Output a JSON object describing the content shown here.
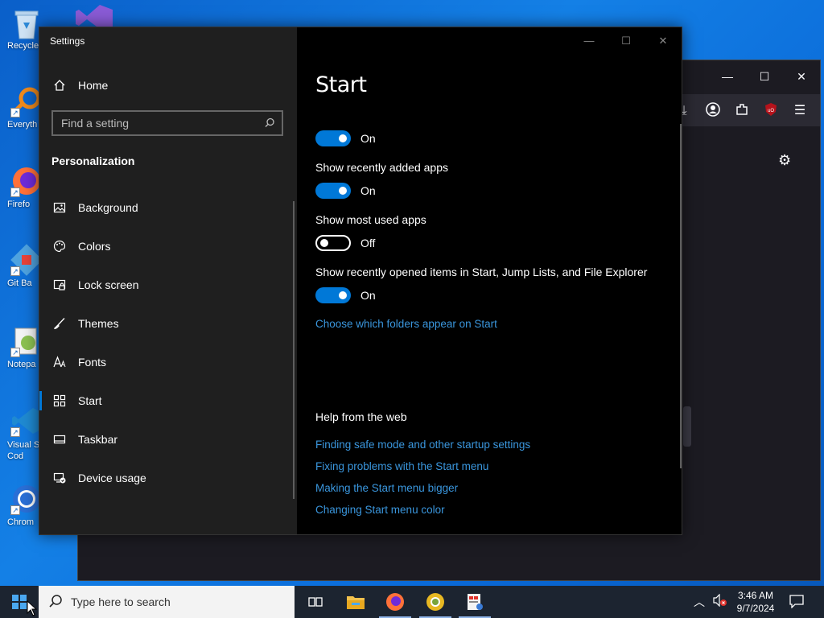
{
  "desktop": {
    "icons": [
      {
        "label": "Recycle",
        "icon": "recycle-bin-icon"
      },
      {
        "label": "Everyth",
        "icon": "everything-search-icon"
      },
      {
        "label": "Firefo",
        "icon": "firefox-icon"
      },
      {
        "label": "Git Ba",
        "icon": "git-bash-icon"
      },
      {
        "label": "Notepa",
        "icon": "notepad-plus-plus-icon"
      },
      {
        "label": "Visual St\nCod",
        "icon": "vscode-icon"
      },
      {
        "label": "Chrom",
        "icon": "chrome-icon"
      }
    ]
  },
  "settings": {
    "app_title": "Settings",
    "home_label": "Home",
    "search_placeholder": "Find a setting",
    "section_title": "Personalization",
    "nav": [
      {
        "label": "Background",
        "icon": "picture-icon"
      },
      {
        "label": "Colors",
        "icon": "palette-icon"
      },
      {
        "label": "Lock screen",
        "icon": "lock-screen-icon"
      },
      {
        "label": "Themes",
        "icon": "brush-icon"
      },
      {
        "label": "Fonts",
        "icon": "fonts-icon"
      },
      {
        "label": "Start",
        "icon": "start-grid-icon",
        "active": true
      },
      {
        "label": "Taskbar",
        "icon": "taskbar-icon"
      },
      {
        "label": "Device usage",
        "icon": "device-usage-icon"
      }
    ],
    "page_heading": "Start",
    "toggles": [
      {
        "label": "",
        "state": "On",
        "on": true
      },
      {
        "label": "Show recently added apps",
        "state": "On",
        "on": true
      },
      {
        "label": "Show most used apps",
        "state": "Off",
        "on": false
      },
      {
        "label": "Show recently opened items in Start, Jump Lists, and File Explorer",
        "state": "On",
        "on": true
      }
    ],
    "folders_link": "Choose which folders appear on Start",
    "help_title": "Help from the web",
    "help_links": [
      "Finding safe mode and other startup settings",
      "Fixing problems with the Start menu",
      "Making the Start menu bigger",
      "Changing Start menu color"
    ]
  },
  "taskbar": {
    "search_placeholder": "Type here to search",
    "time": "3:46 AM",
    "date": "9/7/2024",
    "apps": [
      "task-view-icon",
      "file-explorer-icon",
      "firefox-icon",
      "chrome-canary-icon",
      "app-icon"
    ]
  },
  "colors": {
    "accent": "#0078d7",
    "link": "#3a96dd"
  }
}
